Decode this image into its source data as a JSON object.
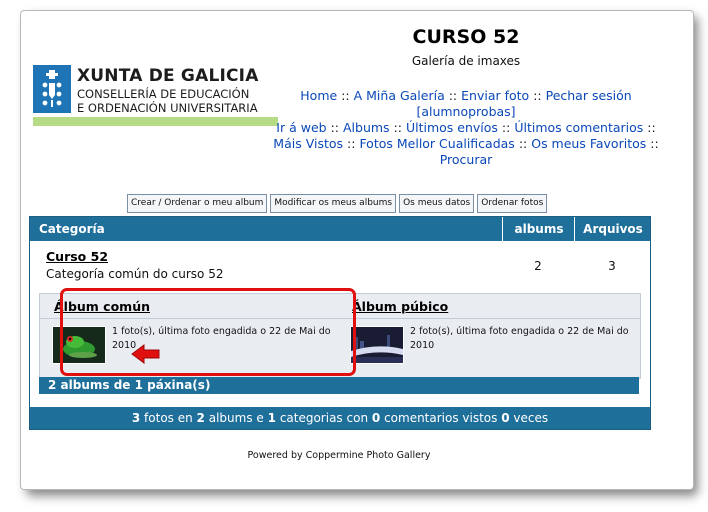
{
  "header": {
    "logo_title": "XUNTA DE GALICIA",
    "logo_line1": "CONSELLERÍA DE EDUCACIÓN",
    "logo_line2": "E ORDENACIÓN UNIVERSITARIA",
    "title": "CURSO 52",
    "subtitle": "Galería de imaxes"
  },
  "nav": {
    "home": "Home",
    "my_gallery": "A Miña Galería",
    "upload": "Enviar foto",
    "logout": "Pechar sesión [alumnoprobas]",
    "go_web": "Ir á web",
    "albums": "Albums",
    "last_uploads": "Últimos envíos",
    "last_comments": "Últimos comentarios",
    "most_viewed": "Máis Vistos",
    "top_rated": "Fotos Mellor Cualificadas",
    "favorites": "Os meus Favoritos",
    "search": "Procurar",
    "separator": "::"
  },
  "buttons": {
    "create_album": "Crear / Ordenar o meu album",
    "modify_albums": "Modificar os meus albums",
    "my_data": "Os meus datos",
    "sort_photos": "Ordenar fotos"
  },
  "table": {
    "headers": {
      "category": "Categoría",
      "albums": "albums",
      "files": "Arquivos"
    },
    "category": {
      "name": "Curso 52",
      "description": "Categoría común do curso 52",
      "albums": "2",
      "files": "3"
    },
    "albums": [
      {
        "title": "Álbum común",
        "info": "1 foto(s), última foto engadida o 22 de Mai do 2010"
      },
      {
        "title": "Álbum púbico",
        "info": "2 foto(s), última foto engadida o 22 de Mai do 2010"
      }
    ],
    "albums_footer": "2 albums de 1 páxina(s)"
  },
  "stats": {
    "photos": "3",
    "t1": "fotos en",
    "albums": "2",
    "t2": "albums e",
    "categories": "1",
    "t3": "categorias con",
    "comments": "0",
    "t4": "comentarios vistos",
    "views": "0",
    "t5": "veces"
  },
  "footer": {
    "powered": "Powered by Coppermine Photo Gallery"
  },
  "colors": {
    "header_bar": "#1f6f9b",
    "link": "#0b48b8",
    "highlight": "#e01010",
    "logo_blue": "#1f74b5",
    "logo_green": "#b5dc85"
  },
  "icons": {
    "emblem": "xunta-emblem-icon",
    "arrow": "red-arrow-icon"
  }
}
